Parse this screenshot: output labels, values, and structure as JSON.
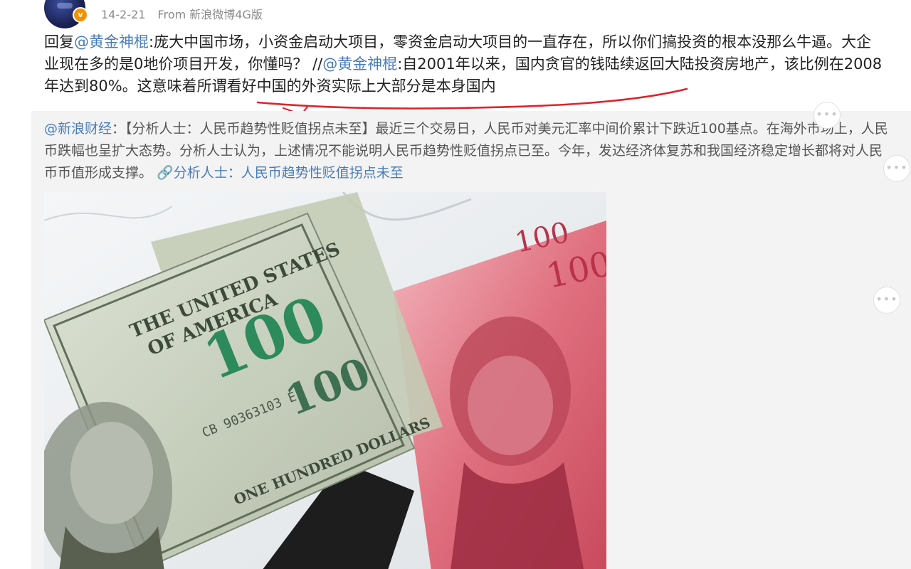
{
  "post": {
    "timestamp": "14-2-21",
    "source": "From 新浪微博4G版",
    "verified_badge": "v",
    "reply_segments": [
      {
        "text": "回复",
        "type": "text"
      },
      {
        "text": "@黄金神棍",
        "type": "mention"
      },
      {
        "text": ":庞大中国市场，小资金启动大项目，零资金启动大项目的一直存在，所以你们搞投资的根本没那么牛逼。大企业现在多的是0地价项目开发，你懂吗？ //",
        "type": "text"
      },
      {
        "text": "@黄金神棍",
        "type": "mention"
      },
      {
        "text": ":自2001年以来，国内贪官的钱陆续返回大陆投资房地产，该比例在2008年达到80%。这意味着所谓看好中国的外资实际上大部分是本身国内",
        "type": "text"
      }
    ]
  },
  "retweet": {
    "author": "@新浪财经",
    "separator": "：",
    "body": "【分析人士：人民币趋势性贬值拐点未至】最近三个交易日，人民币对美元汇率中间价累计下跌近100基点。在海外市场上，人民币跌幅也呈扩大态势。分析人士认为，上述情况不能说明人民币趋势性贬值拐点已至。今年，发达经济体复苏和我国经济稳定增长都将对人民币币值形成支撑。",
    "link_label": "分析人士：人民币趋势性贬值拐点未至"
  },
  "image": {
    "usd_text_1": "THE UNITED STATES",
    "usd_text_2": "OF AMERICA",
    "usd_serial": "CB 90363103 E",
    "usd_denomination": "100",
    "usd_words": "ONE HUNDRED DOLLARS",
    "cny_denomination": "100"
  },
  "icons": {
    "more": "more-dots-icon",
    "link": "link-icon"
  },
  "colors": {
    "mention": "#4a7cb8",
    "annotation": "#d9262b",
    "badge": "#f29100"
  }
}
